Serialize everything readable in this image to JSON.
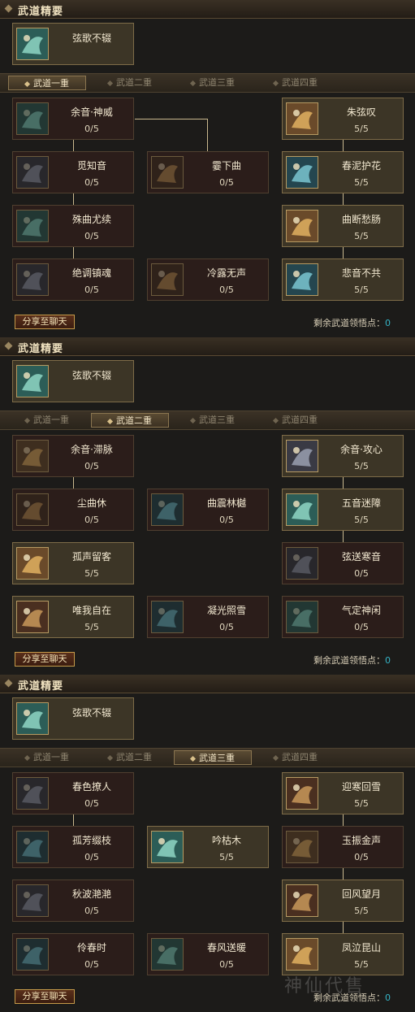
{
  "labels": {
    "essentials_title": "武道精要",
    "share_button": "分享至聊天",
    "remaining_points_label": "剩余武道领悟点："
  },
  "tabs": [
    "武道一重",
    "武道二重",
    "武道三重",
    "武道四重"
  ],
  "watermark": "神仙代售",
  "panels": [
    {
      "active_tab": 0,
      "essential": "弦歌不辍",
      "remaining_points": "0",
      "skills": [
        {
          "name": "余音·神威",
          "level": "0/5",
          "learned": false
        },
        {
          "name": "朱弦叹",
          "level": "5/5",
          "learned": true
        },
        {
          "name": "觅知音",
          "level": "0/5",
          "learned": false
        },
        {
          "name": "霎下曲",
          "level": "0/5",
          "learned": false
        },
        {
          "name": "春泥护花",
          "level": "5/5",
          "learned": true
        },
        {
          "name": "殊曲尤续",
          "level": "0/5",
          "learned": false
        },
        {
          "name": "曲断愁肠",
          "level": "5/5",
          "learned": true
        },
        {
          "name": "绝调镇魂",
          "level": "0/5",
          "learned": false
        },
        {
          "name": "冷露无声",
          "level": "0/5",
          "learned": false
        },
        {
          "name": "悲音不共",
          "level": "5/5",
          "learned": true
        }
      ]
    },
    {
      "active_tab": 1,
      "essential": "弦歌不辍",
      "remaining_points": "0",
      "skills": [
        {
          "name": "余音·滞脉",
          "level": "0/5",
          "learned": false
        },
        {
          "name": "余音·攻心",
          "level": "5/5",
          "learned": true
        },
        {
          "name": "尘曲休",
          "level": "0/5",
          "learned": false
        },
        {
          "name": "曲震林樾",
          "level": "0/5",
          "learned": false
        },
        {
          "name": "五音迷障",
          "level": "5/5",
          "learned": true
        },
        {
          "name": "孤声留客",
          "level": "5/5",
          "learned": true
        },
        {
          "name": "弦送寒音",
          "level": "0/5",
          "learned": false
        },
        {
          "name": "唯我自在",
          "level": "5/5",
          "learned": true
        },
        {
          "name": "凝光照雪",
          "level": "0/5",
          "learned": false
        },
        {
          "name": "气定神闲",
          "level": "0/5",
          "learned": false
        }
      ]
    },
    {
      "active_tab": 2,
      "essential": "弦歌不辍",
      "remaining_points": "0",
      "skills": [
        {
          "name": "春色撩人",
          "level": "0/5",
          "learned": false
        },
        {
          "name": "迎寒回雪",
          "level": "5/5",
          "learned": true
        },
        {
          "name": "孤芳缀枝",
          "level": "0/5",
          "learned": false
        },
        {
          "name": "吟枯木",
          "level": "5/5",
          "learned": true
        },
        {
          "name": "玉振金声",
          "level": "0/5",
          "learned": false
        },
        {
          "name": "秋波滟滟",
          "level": "0/5",
          "learned": false
        },
        {
          "name": "回风望月",
          "level": "5/5",
          "learned": true
        },
        {
          "name": "伶春时",
          "level": "0/5",
          "learned": false
        },
        {
          "name": "春风送暖",
          "level": "0/5",
          "learned": false
        },
        {
          "name": "凤泣昆山",
          "level": "5/5",
          "learned": true
        }
      ]
    }
  ]
}
